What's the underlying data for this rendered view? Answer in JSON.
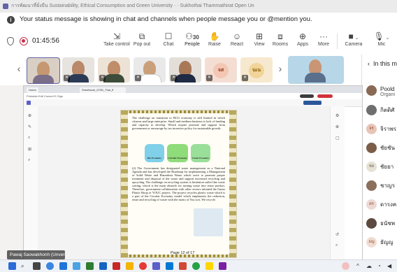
{
  "titlebar": {
    "text": "การพัฒนาที่ยั่งยืน Sustainability, Ethical Consumption and Green University  ·  · Sukhothai Thammathirat Open Un"
  },
  "banner": {
    "info_icon": "info-icon",
    "text": "Your status message is showing in chat and channels when people message you or @mention you."
  },
  "meeting": {
    "timer": "01:45:56",
    "people_count": "30",
    "toolbar": [
      {
        "label": "Take control",
        "icon": "take-control-icon",
        "glyph": "⇲"
      },
      {
        "label": "Pop out",
        "icon": "pop-out-icon",
        "glyph": "⧉"
      },
      {
        "label": "Chat",
        "icon": "chat-icon",
        "glyph": "💬"
      },
      {
        "label": "People",
        "icon": "people-icon",
        "glyph": "👥"
      },
      {
        "label": "Raise",
        "icon": "raise-hand-icon",
        "glyph": "✋"
      },
      {
        "label": "React",
        "icon": "react-icon",
        "glyph": "☺"
      },
      {
        "label": "View",
        "icon": "view-icon",
        "glyph": "⊞"
      },
      {
        "label": "Rooms",
        "icon": "rooms-icon",
        "glyph": "⧈"
      },
      {
        "label": "Apps",
        "icon": "apps-icon",
        "glyph": "⊕"
      },
      {
        "label": "More",
        "icon": "more-icon",
        "glyph": "···"
      },
      {
        "label": "Camera",
        "icon": "camera-icon",
        "glyph": "■"
      },
      {
        "label": "Mic",
        "icon": "mic-icon",
        "glyph": "🎙"
      }
    ]
  },
  "participants": [
    {
      "initials": "",
      "kind": "photo-woman"
    },
    {
      "initials": "",
      "kind": "photo-man"
    },
    {
      "initials": "",
      "kind": "photo-woman2"
    },
    {
      "initials": "",
      "kind": "photo-man2"
    },
    {
      "initials": "",
      "kind": "photo-man3"
    },
    {
      "initials": "จส",
      "kind": "initials"
    },
    {
      "initials": "นเน",
      "kind": "initials"
    },
    {
      "initials": "",
      "kind": "photo-woman3"
    }
  ],
  "panel": {
    "title": "In this m",
    "items": [
      {
        "name": "Poold",
        "sub": "Organi",
        "initials": ""
      },
      {
        "name": "กิตติศั",
        "sub": "",
        "initials": ""
      },
      {
        "name": "จิราพร",
        "sub": "",
        "initials": "จร"
      },
      {
        "name": "ชัยชัน",
        "sub": "",
        "initials": ""
      },
      {
        "name": "ชัยยา",
        "sub": "",
        "initials": "ชย"
      },
      {
        "name": "ชาญร",
        "sub": "",
        "initials": ""
      },
      {
        "name": "ดารงค",
        "sub": "",
        "initials": "ดร"
      },
      {
        "name": "ธนัชพ",
        "sub": "",
        "initials": ""
      },
      {
        "name": "ธัญญ",
        "sub": "",
        "initials": "ธญ"
      }
    ]
  },
  "shared": {
    "tab1": "Home",
    "tab2": "Sheetbook_ICSD_Thai_ff",
    "toolbar_left": "Printable  Edit  Convert  E-Sign",
    "page_text_1": "The challenge on transition to BCG economy is still limited in which citizens and large enterprise. Small and medium business is lack of funding and capacity to develop. Which require promote and support from government or encourage by tax incentive policy for sustainable growth.",
    "figure_labels": [
      "Bio Economy",
      "Circular Economy",
      "Green Economy"
    ],
    "page_text_2": "(2) The Government has designated waste management as a National Agenda and has developed the Roadmap for implementing a Management of Solid Waste and Hazardous Waste which serve to promote proper treatment and disposal of the waste and support increased recycling and upcycling. The challenge on recycling system is limitation suffer like waste sorting, which is the main obstacle for turning waste into reuse product. Therefore, government collaboration with other sectors initiated the Gamo Plastic Hoop or YOUC project. The project recycles plastic waste which is a part of the Circular Economy model which emphasizes the reduction, reuse and recycling of waste with the motto of You sort, We recycle.",
    "page_indicator": "Page 12 of 17"
  },
  "caption": "Pawaj Saowakhonh (Unverified)",
  "colors": {
    "accent": "#5b5fc7",
    "record": "#c4314b"
  }
}
